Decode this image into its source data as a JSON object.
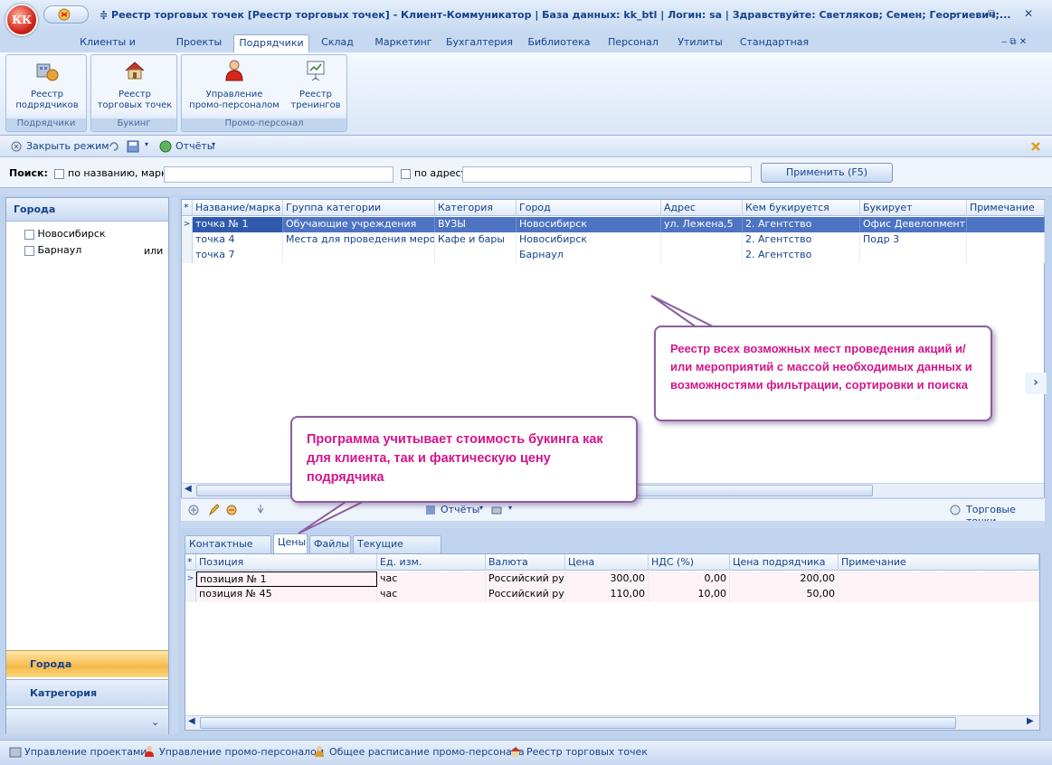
{
  "window": {
    "app_logo": "КК",
    "title": "≑ Реестр торговых точек [Реестр торговых точек] - Клиент-Коммуникатор | База данных: kk_btl | Логин: sa | Здравствуйте: Светляков; Семен; Георгиевич;...",
    "minimize": "‒",
    "restore": "⧉",
    "close": "✕",
    "mdi_controls": "‒  ⧉  ✕"
  },
  "ribbon_tabs": [
    "Клиенты и Продажи",
    "Проекты",
    "Подрядчики",
    "Склад",
    "Маркетинг",
    "Бухгалтерия",
    "Библиотека",
    "Персонал",
    "Утилиты",
    "Стандартная"
  ],
  "ribbon_groups": [
    {
      "label": "Подрядчики",
      "buttons": [
        {
          "line1": "Реестр",
          "line2": "подрядчиков"
        }
      ]
    },
    {
      "label": "Букинг",
      "buttons": [
        {
          "line1": "Реестр",
          "line2": "торговых точек"
        }
      ]
    },
    {
      "label": "Промо-персонал",
      "buttons": [
        {
          "line1": "Управление",
          "line2": "промо-персоналом"
        },
        {
          "line1": "Реестр",
          "line2": "тренингов"
        }
      ]
    }
  ],
  "toolbar": {
    "close_mode": "Закрыть режим",
    "reports": "Отчёты"
  },
  "search": {
    "label": "Поиск:",
    "by_name": "по названию, марке",
    "by_address": "по адресу",
    "apply": "Применить (F5)"
  },
  "left_panel": {
    "header": "Города",
    "cities": [
      "Новосибирск",
      "Барнаул"
    ],
    "or_label": "или",
    "nav_cities": "Города",
    "nav_category": "Катрегория",
    "chevron": "⌄"
  },
  "grid1": {
    "columns": [
      "Название/марка",
      "Группа категории",
      "Категория",
      "Город",
      "Адрес",
      "Кем букируется",
      "Букирует",
      "Примечание"
    ],
    "rows": [
      [
        "точка № 1",
        "Обучающие учреждения",
        "ВУЗЫ",
        "Новосибирск",
        "ул. Лежена,5",
        "2. Агентство",
        "Офис Девелопмент",
        ""
      ],
      [
        "точка 4",
        "Места для проведения мероприятий",
        "Кафе и бары",
        "Новосибирск",
        "",
        "2. Агентство",
        "Подр 3",
        ""
      ],
      [
        "точка 7",
        "",
        "",
        "Барнаул",
        "",
        "2. Агентство",
        "",
        ""
      ]
    ]
  },
  "detail_toolbar": {
    "reports": "Отчёты",
    "trade_points": "Торговые точки"
  },
  "detail_tabs": [
    "Контактные лица",
    "Цены",
    "Файлы",
    "Текущие проекты"
  ],
  "grid2": {
    "columns": [
      "Позиция",
      "Ед. изм.",
      "Валюта",
      "Цена",
      "НДС (%)",
      "Цена подрядчика",
      "Примечание"
    ],
    "rows": [
      [
        "позиция № 1",
        "час",
        "Российский рубль",
        "300,00",
        "0,00",
        "200,00",
        ""
      ],
      [
        "позиция № 45",
        "час",
        "Российский рубль",
        "110,00",
        "10,00",
        "50,00",
        ""
      ]
    ]
  },
  "callouts": {
    "registry": "Реестр всех возможных мест проведения акций и/или мероприятий с массой необходимых данных и возможностями фильтрации, сортировки и поиска",
    "booking": "Программа учитывает стоимость букинга как для клиента, так и фактическую цену подрядчика"
  },
  "statusbar": [
    "Управление проектами",
    "Управление промо-персоналом",
    "Общее расписание промо-персонала",
    "Реестр торговых точек"
  ],
  "colors": {
    "accent": "#15428b",
    "selection": "#4d73c2",
    "callout_text": "#d4148c",
    "nav_active": "#f6b94a"
  }
}
